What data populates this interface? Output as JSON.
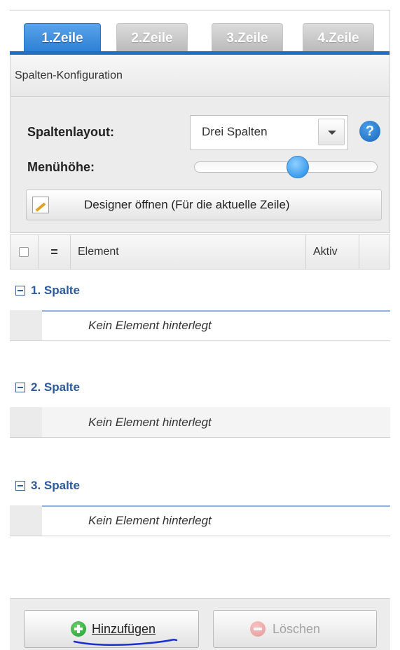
{
  "tabs": [
    {
      "label": "1.Zeile",
      "active": true
    },
    {
      "label": "2.Zeile",
      "active": false
    },
    {
      "label": "3.Zeile",
      "active": false
    },
    {
      "label": "4.Zeile",
      "active": false
    }
  ],
  "section_title": "Spalten-Konfiguration",
  "config": {
    "layout_label": "Spaltenlayout:",
    "layout_value": "Drei Spalten",
    "help_glyph": "?",
    "menu_height_label": "Menühöhe:",
    "menu_height_level": 0.55,
    "designer_button": "Designer öffnen (Für die aktuelle Zeile)"
  },
  "table": {
    "col_element": "Element",
    "col_aktiv": "Aktiv",
    "col_order_glyph": "="
  },
  "groups": [
    {
      "title": "1. Spalte",
      "empty_text": "Kein Element hinterlegt"
    },
    {
      "title": "2. Spalte",
      "empty_text": "Kein Element hinterlegt"
    },
    {
      "title": "3. Spalte",
      "empty_text": "Kein Element hinterlegt"
    }
  ],
  "buttons": {
    "add": "Hinzufügen",
    "delete": "Löschen"
  },
  "colors": {
    "accent": "#2b7fd3",
    "group_text": "#2c5a9a",
    "add_icon": "#1d9a2e",
    "delete_icon": "#e25454"
  }
}
